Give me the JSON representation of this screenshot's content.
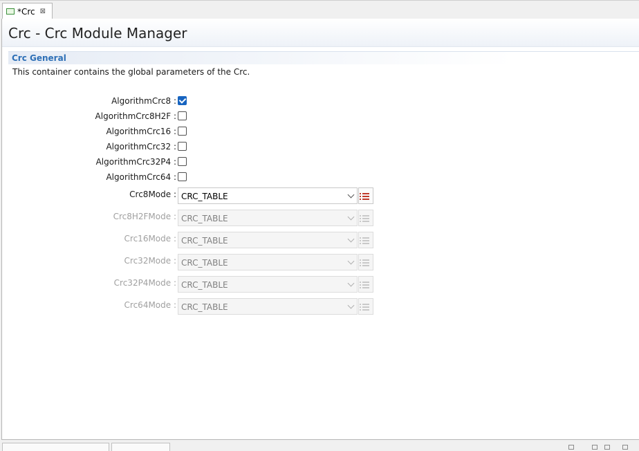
{
  "tab": {
    "label": "*Crc",
    "close": "⊠"
  },
  "page_title": "Crc - Crc Module Manager",
  "section": {
    "title": "Crc General",
    "description": "This container contains the global parameters of the Crc."
  },
  "checkboxes": [
    {
      "label": "AlgorithmCrc8 :",
      "checked": true
    },
    {
      "label": "AlgorithmCrc8H2F :",
      "checked": false
    },
    {
      "label": "AlgorithmCrc16 :",
      "checked": false
    },
    {
      "label": "AlgorithmCrc32 :",
      "checked": false
    },
    {
      "label": "AlgorithmCrc32P4 :",
      "checked": false
    },
    {
      "label": "AlgorithmCrc64 :",
      "checked": false
    }
  ],
  "modes": [
    {
      "label": "Crc8Mode :",
      "value": "CRC_TABLE",
      "enabled": true
    },
    {
      "label": "Crc8H2FMode :",
      "value": "CRC_TABLE",
      "enabled": false
    },
    {
      "label": "Crc16Mode :",
      "value": "CRC_TABLE",
      "enabled": false
    },
    {
      "label": "Crc32Mode :",
      "value": "CRC_TABLE",
      "enabled": false
    },
    {
      "label": "Crc32P4Mode :",
      "value": "CRC_TABLE",
      "enabled": false
    },
    {
      "label": "Crc64Mode :",
      "value": "CRC_TABLE",
      "enabled": false
    }
  ],
  "colors": {
    "accent": "#2d6fb6",
    "checkbox": "#1764c0",
    "list_icon": "#c0392b"
  }
}
